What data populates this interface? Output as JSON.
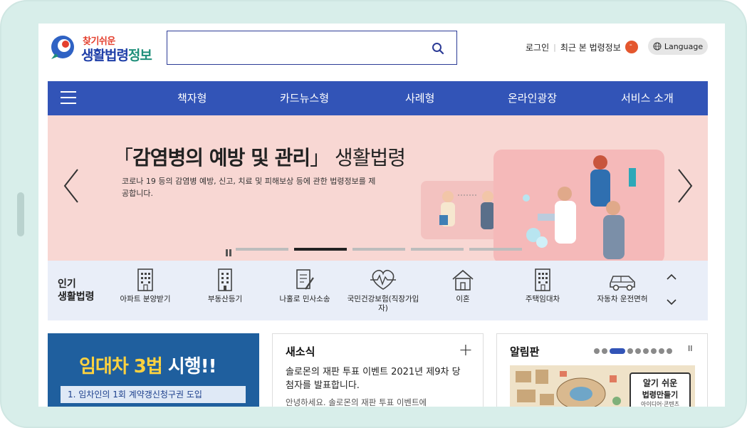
{
  "header": {
    "logo_sub": "찾기쉬운",
    "logo_main_a": "생활법령",
    "logo_main_b": "정보",
    "search_placeholder": "",
    "login": "로그인",
    "recent": "최근 본 법령정보",
    "language": "Language"
  },
  "nav": {
    "items": [
      "책자형",
      "카드뉴스형",
      "사례형",
      "온라인광장",
      "서비스 소개"
    ]
  },
  "banner": {
    "title_bracket_open": "「",
    "title_bold": "감염병의 예방 및 관리",
    "title_bracket_close": "」",
    "title_light": " 생활법령",
    "desc": "코로나 19 등의 감염병 예방, 신고, 치료 및 피해보상 등에 관한 법령정보를 제공합니다.",
    "active_page_index": 1
  },
  "popular": {
    "label_line1": "인기",
    "label_line2": "생활법령",
    "items": [
      {
        "label": "아파트 분양받기",
        "icon": "apartment-icon"
      },
      {
        "label": "부동산등기",
        "icon": "building-icon"
      },
      {
        "label": "나홀로 민사소송",
        "icon": "document-pen-icon"
      },
      {
        "label": "국민건강보험(직장가입자)",
        "icon": "heartbeat-icon"
      },
      {
        "label": "이혼",
        "icon": "house-icon"
      },
      {
        "label": "주택임대차",
        "icon": "apartment-icon"
      },
      {
        "label": "자동차 운전면허",
        "icon": "car-icon"
      }
    ]
  },
  "promo": {
    "headline_a": "임대차 3법",
    "headline_b": " 시행!!",
    "sub": "1. 임차인의 1회 계약갱신청구권 도입"
  },
  "news": {
    "title": "새소식",
    "plus": "+",
    "headline": "솔로몬의 재판 투표 이벤트 2021년 제9차 당첨자를 발표합니다.",
    "body": "안녕하세요. 솔로몬의 재판 투표 이벤트에"
  },
  "notice": {
    "title": "알림판",
    "pause": "II",
    "tag_l1": "알기 쉬운",
    "tag_l2": "법령만들기",
    "tag_l3": "아이디어·콘텐츠"
  }
}
